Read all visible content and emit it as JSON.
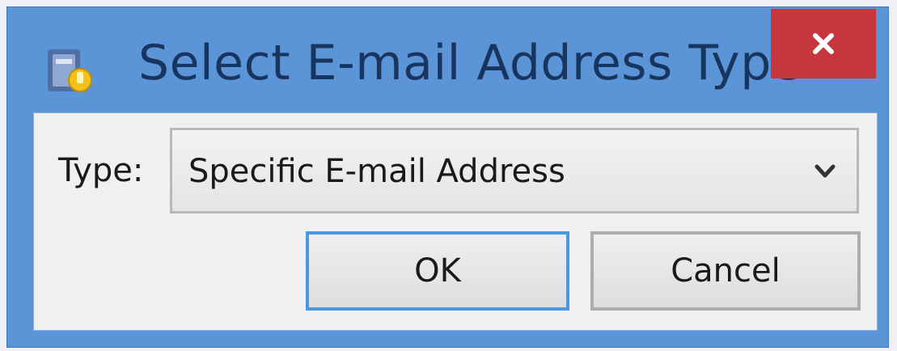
{
  "dialog": {
    "title": "Select E-mail Address Type",
    "close_symbol": "×",
    "app_icon": "address-book-icon"
  },
  "form": {
    "type_label": "Type:",
    "type_value": "Specific E-mail Address"
  },
  "buttons": {
    "ok": "OK",
    "cancel": "Cancel"
  },
  "colors": {
    "window_border": "#5c95d7",
    "close_button": "#c7353d",
    "title_text": "#17355f",
    "focus_ring": "#4c97e0"
  }
}
